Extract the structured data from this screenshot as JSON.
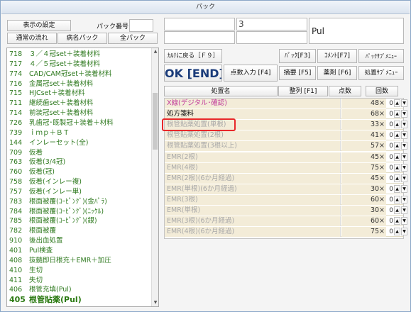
{
  "window": {
    "title": "パック"
  },
  "top": {
    "display_settings": "表示の設定",
    "pack_number_label": "パック番号",
    "normal_flow": "通常の流れ",
    "disease_pack": "病名パック",
    "all_pack": "全パック",
    "header_count": "3",
    "header_name": "Pul"
  },
  "actions": {
    "back": "ｶﾙﾃに戻る［Ｆ９］",
    "ok": "OK [END]",
    "score_input": "点数入力 [F4]",
    "pack": "ﾊﾟｯｸ[F3]",
    "comment": "ｺﾒﾝﾄ[F7]",
    "pack_submenu": "ﾊﾟｯｸｻﾌﾞﾒﾆｭｰ",
    "summary": "摘要 [F5]",
    "drug": "薬剤 [F6]",
    "treatment_submenu": "処置ｻﾌﾞﾒﾆｭｰ"
  },
  "table_header": {
    "treatment_name": "処置名",
    "sort": "整列 [F1]",
    "points": "点数",
    "times": "回数"
  },
  "pack_list": [
    {
      "code": "718",
      "name": "３／４冠set＋装着材料"
    },
    {
      "code": "717",
      "name": "４／５冠set＋装着材料"
    },
    {
      "code": "774",
      "name": "CAD/CAM冠set＋装着材料"
    },
    {
      "code": "716",
      "name": "金属冠set＋装着材料"
    },
    {
      "code": "715",
      "name": "HJCset＋装着材料"
    },
    {
      "code": "711",
      "name": "継続歯set＋装着材料"
    },
    {
      "code": "714",
      "name": "前装冠set＋装着材料"
    },
    {
      "code": "726",
      "name": "乳歯冠･既製冠＋装着＋材料"
    },
    {
      "code": "739",
      "name": "ｉｍｐ＋ＢＴ"
    },
    {
      "code": "144",
      "name": "インレーセット(全)"
    },
    {
      "code": "709",
      "name": "仮着"
    },
    {
      "code": "763",
      "name": "仮着(3/4冠)"
    },
    {
      "code": "760",
      "name": "仮着(冠)"
    },
    {
      "code": "758",
      "name": "仮着(インレー複)"
    },
    {
      "code": "757",
      "name": "仮着(インレー単)"
    },
    {
      "code": "783",
      "name": "根面被覆(ｺｰﾋﾟﾝｸﾞ)(金ﾊﾟﾗ)"
    },
    {
      "code": "784",
      "name": "根面被覆(ｺｰﾋﾟﾝｸﾞ)(ﾆｯｹﾙ)"
    },
    {
      "code": "785",
      "name": "根面被覆(ｺｰﾋﾟﾝｸﾞ)(銀)"
    },
    {
      "code": "782",
      "name": "根面被覆"
    },
    {
      "code": "910",
      "name": "後出血処置"
    },
    {
      "code": "401",
      "name": "Pul検査"
    },
    {
      "code": "408",
      "name": "抜髄即日根充＋EMR＋加圧"
    },
    {
      "code": "410",
      "name": "生切"
    },
    {
      "code": "411",
      "name": "失切"
    },
    {
      "code": "406",
      "name": "根管充填(Pul)"
    },
    {
      "code": "405",
      "name": "根管貼薬(Pul)"
    }
  ],
  "treatments": [
    {
      "name": "X線(デジタル･確認)",
      "points": "48",
      "count": "0"
    },
    {
      "name": "処方箋料",
      "points": "68",
      "count": "0"
    },
    {
      "name": "根管貼薬処置(単根)",
      "points": "33",
      "count": "0"
    },
    {
      "name": "根管貼薬処置(2根)",
      "points": "41",
      "count": "0"
    },
    {
      "name": "根管貼薬処置(3根以上)",
      "points": "57",
      "count": "0"
    },
    {
      "name": "EMR(2根)",
      "points": "45",
      "count": "0"
    },
    {
      "name": "EMR(4根)",
      "points": "75",
      "count": "0"
    },
    {
      "name": "EMR(2根)(6か月経過)",
      "points": "45",
      "count": "0"
    },
    {
      "name": "EMR(単根)(6か月経過)",
      "points": "30",
      "count": "0"
    },
    {
      "name": "EMR(3根)",
      "points": "60",
      "count": "0"
    },
    {
      "name": "EMR(単根)",
      "points": "30",
      "count": "0"
    },
    {
      "name": "EMR(3根)(6か月経過)",
      "points": "60",
      "count": "0"
    },
    {
      "name": "EMR(4根)(6か月経過)",
      "points": "75",
      "count": "0"
    }
  ],
  "symbols": {
    "up": "▲",
    "down": "▼",
    "times": "×",
    "scroll_up": "▲",
    "scroll_down": "▼"
  },
  "colors": {
    "list_text": "#2f7a1f",
    "active_treatment": "#c0399a",
    "inactive_treatment": "#a8a8a8",
    "row_bg": "#f3ecd8",
    "highlight": "#e8282a",
    "ok_text": "#1b3c7a"
  }
}
